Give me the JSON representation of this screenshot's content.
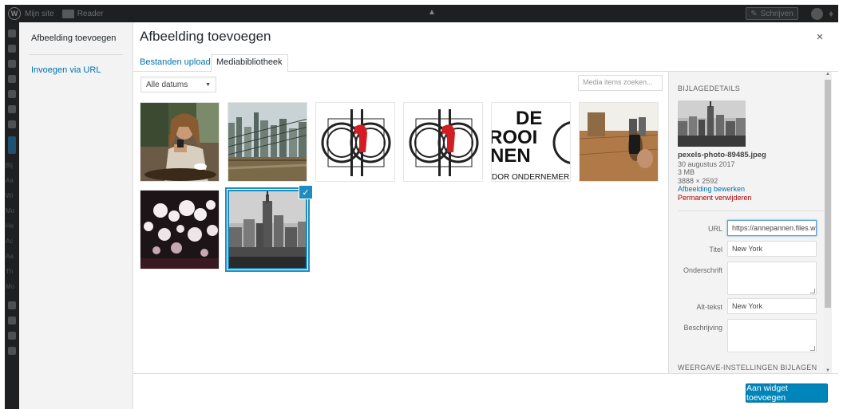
{
  "adminbar": {
    "site_label": "Mijn site",
    "reader_label": "Reader",
    "write_label": "Schrijven"
  },
  "admin_side_labels": [
    "Bij",
    "Aa",
    "Wi",
    "Mo",
    "He",
    "Ac",
    "Aa",
    "Th",
    "Mo"
  ],
  "media_menu": {
    "active_item": "Afbeelding toevoegen",
    "link_item": "Invoegen via URL"
  },
  "frame": {
    "title": "Afbeelding toevoegen",
    "close_label": "×"
  },
  "router": {
    "tabs": [
      {
        "label": "Bestanden uploaden",
        "active": false
      },
      {
        "label": "Mediabibliotheek",
        "active": true
      }
    ]
  },
  "toolbar": {
    "date_filter": "Alle datums",
    "search_placeholder": "Media items zoeken..."
  },
  "attachments": [
    {
      "name": "woman-coffee-phone",
      "selected": false
    },
    {
      "name": "brooklyn-bridge-skyline",
      "selected": false
    },
    {
      "name": "logo-cdp-1",
      "selected": false
    },
    {
      "name": "logo-cdp-2",
      "selected": false
    },
    {
      "name": "de-rooi-pannen-logo",
      "selected": false
    },
    {
      "name": "phone-on-table",
      "selected": false
    },
    {
      "name": "bokeh-lights",
      "selected": false
    },
    {
      "name": "new-york-skyline",
      "selected": true
    }
  ],
  "logo_text": {
    "line1": "DE",
    "line2": "ROOI",
    "line3": "NEN",
    "line4": "DOR ONDERNEMERSO"
  },
  "sidebar": {
    "heading": "BIJLAGEDETAILS",
    "filename": "pexels-photo-89485.jpeg",
    "date": "30 augustus 2017",
    "size": "3 MB",
    "dimensions": "3888 × 2592",
    "edit_link": "Afbeelding bewerken",
    "delete_link": "Permanent verwijderen",
    "fields": {
      "url_label": "URL",
      "url_value": "https://annepannen.files.wordpress.com",
      "title_label": "Titel",
      "title_value": "New York",
      "caption_label": "Onderschrift",
      "alt_label": "Alt-tekst",
      "alt_value": "New York",
      "description_label": "Beschrijving"
    },
    "display_settings_title": "WEERGAVE-INSTELLINGEN BIJLAGEN"
  },
  "footer": {
    "insert_button": "Aan widget toevoegen"
  },
  "colors": {
    "accent": "#0073aa",
    "primary_button": "#0085ba",
    "selection": "#1e8cbe",
    "delete": "#aa0000"
  }
}
